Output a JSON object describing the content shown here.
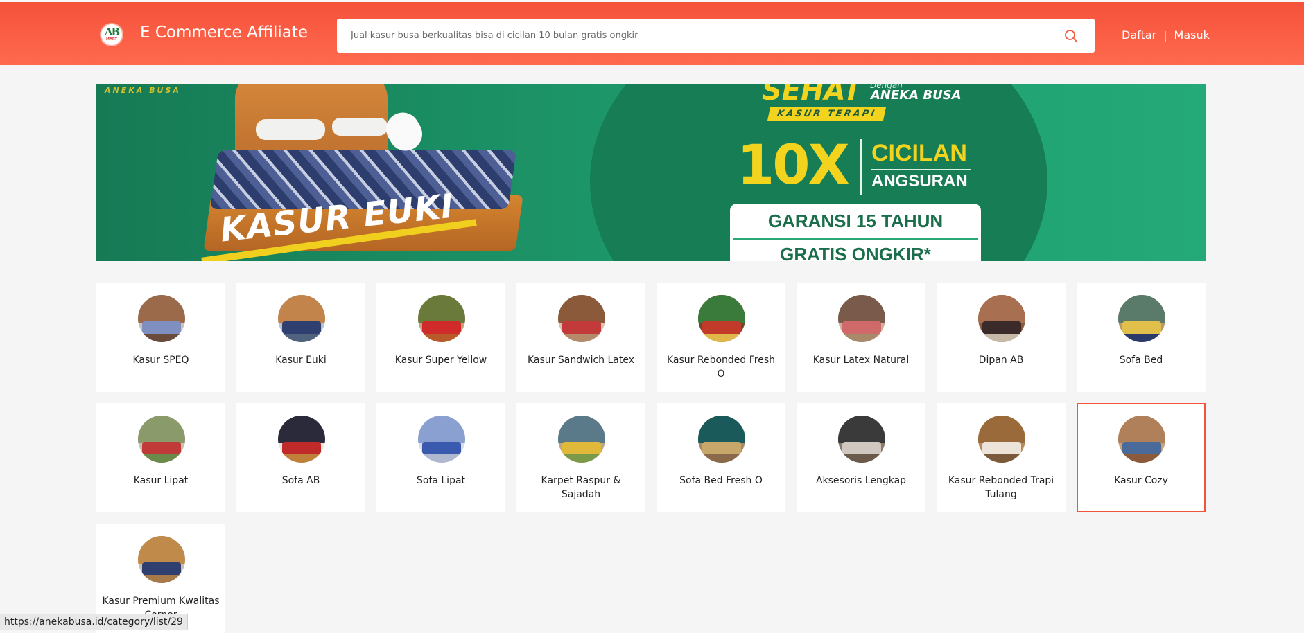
{
  "header": {
    "logo_text": "AB",
    "logo_subtext": "MART",
    "brand": "E Commerce Affiliate",
    "search_placeholder": "Jual kasur busa berkualitas bisa di cicilan 10 bulan gratis ongkir",
    "search_icon": "search-icon",
    "register_label": "Daftar",
    "separator": "|",
    "login_label": "Masuk"
  },
  "banner": {
    "tag": "ANEKA BUSA",
    "sehat": "SEHAT",
    "dengan": "Dengan",
    "brand": "ANEKA BUSA",
    "terapi": "KASUR TERAPI",
    "tenx": "10X",
    "cicilan": "CICILAN",
    "angsuran": "ANGSURAN",
    "garansi": "GARANSI 15 TAHUN",
    "gratis": "GRATIS ONGKIR*",
    "product": "KASUR EUKI"
  },
  "categories": [
    {
      "label": "Kasur SPEQ"
    },
    {
      "label": "Kasur Euki"
    },
    {
      "label": "Kasur Super Yellow"
    },
    {
      "label": "Kasur Sandwich Latex"
    },
    {
      "label": "Kasur Rebonded Fresh O"
    },
    {
      "label": "Kasur Latex Natural"
    },
    {
      "label": "Dipan AB"
    },
    {
      "label": "Sofa Bed"
    },
    {
      "label": "Kasur Lipat"
    },
    {
      "label": "Sofa AB"
    },
    {
      "label": "Sofa Lipat"
    },
    {
      "label": "Karpet Raspur & Sajadah"
    },
    {
      "label": "Sofa Bed Fresh O"
    },
    {
      "label": "Aksesoris Lengkap"
    },
    {
      "label": "Kasur Rebonded Trapi Tulang"
    },
    {
      "label": "Kasur Cozy"
    },
    {
      "label": "Kasur Premium Kwalitas Corner"
    }
  ],
  "selected_category": "Kasur Cozy",
  "status_bar": "https://anekabusa.id/category/list/29",
  "colors": {
    "header_bg": "#f5523a",
    "accent": "#f5523a",
    "banner_green": "#1e9c6d",
    "page_bg": "#f5f5f5"
  }
}
